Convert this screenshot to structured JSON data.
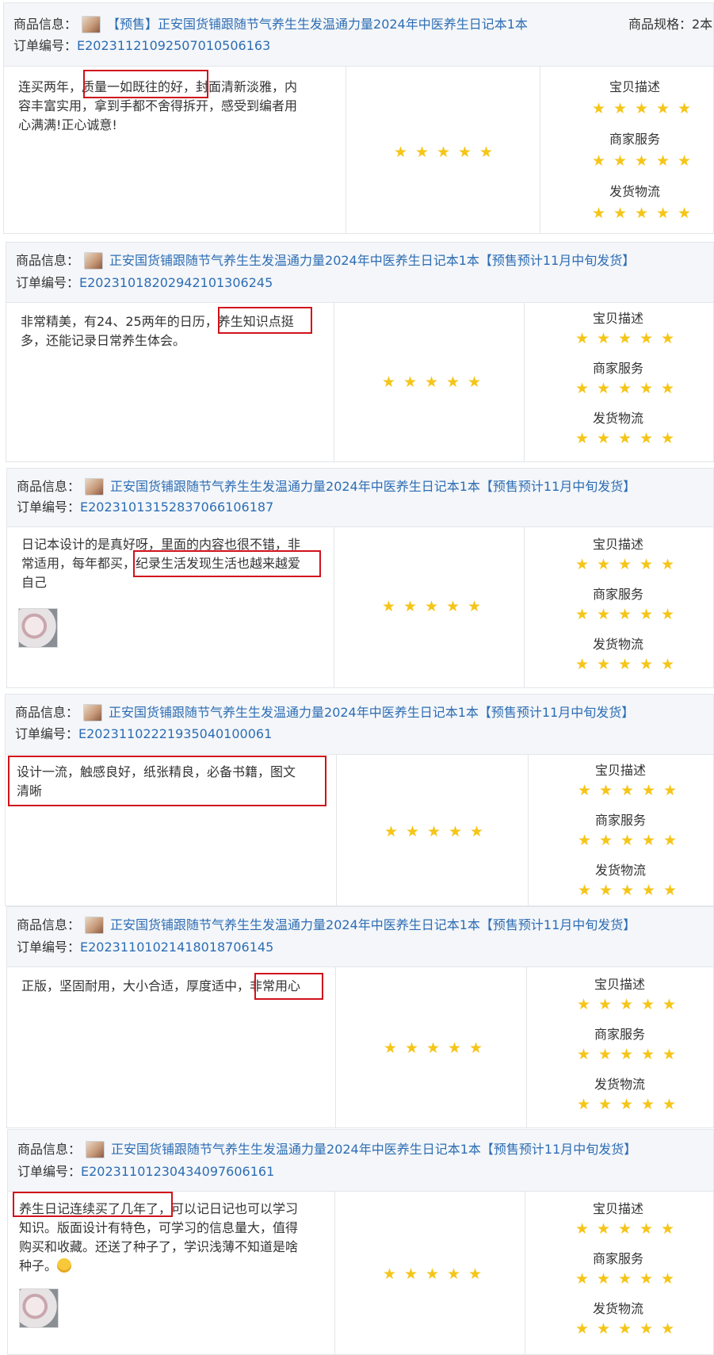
{
  "labels": {
    "product": "商品信息：",
    "order": "订单编号：",
    "spec": "商品规格：2本",
    "desc": "宝贝描述",
    "service": "商家服务",
    "logistics": "发货物流"
  },
  "star_glyph": "★",
  "star_color": "#f5c518",
  "highlight_color": "#d0121b",
  "link_color": "#2d6db4",
  "reviews": [
    {
      "product_title": "【预售】正安国货铺跟随节气养生生发温通力量2024年中医养生日记本1本",
      "order_no": "E20231121092507010506163",
      "text_lines": [
        "连买两年，质量一如既往的好，封面清新淡雅，内",
        "容丰富实用，拿到手都不舍得拆开，感受到编者用",
        "心满满!正心诚意!"
      ],
      "overall_rating": 5,
      "desc_rating": 5,
      "service_rating": 5,
      "logistics_rating": 5
    },
    {
      "product_title": "正安国货铺跟随节气养生生发温通力量2024年中医养生日记本1本【预售预计11月中旬发货】",
      "order_no": "E20231018202942101306245",
      "text_lines": [
        "非常精美，有24、25两年的日历，养生知识点挺",
        "多，还能记录日常养生体会。"
      ],
      "overall_rating": 5,
      "desc_rating": 5,
      "service_rating": 5,
      "logistics_rating": 5
    },
    {
      "product_title": "正安国货铺跟随节气养生生发温通力量2024年中医养生日记本1本【预售预计11月中旬发货】",
      "order_no": "E20231013152837066106187",
      "text_lines": [
        "日记本设计的是真好呀，里面的内容也很不错，非",
        "常适用，每年都买，纪录生活发现生活也越来越爱",
        "自己"
      ],
      "overall_rating": 5,
      "desc_rating": 5,
      "service_rating": 5,
      "logistics_rating": 5
    },
    {
      "product_title": "正安国货铺跟随节气养生生发温通力量2024年中医养生日记本1本【预售预计11月中旬发货】",
      "order_no": "E20231102221935040100061",
      "text_lines": [
        "设计一流，触感良好，纸张精良，必备书籍，图文",
        "清晰"
      ],
      "overall_rating": 5,
      "desc_rating": 5,
      "service_rating": 5,
      "logistics_rating": 5
    },
    {
      "product_title": "正安国货铺跟随节气养生生发温通力量2024年中医养生日记本1本【预售预计11月中旬发货】",
      "order_no": "E20231101021418018706145",
      "text_lines": [
        "正版，坚固耐用，大小合适，厚度适中，非常用心"
      ],
      "overall_rating": 5,
      "desc_rating": 5,
      "service_rating": 5,
      "logistics_rating": 5
    },
    {
      "product_title": "正安国货铺跟随节气养生生发温通力量2024年中医养生日记本1本【预售预计11月中旬发货】",
      "order_no": "E20231101230434097606161",
      "text_lines": [
        "养生日记连续买了几年了，可以记日记也可以学习",
        "知识。版面设计有特色，可学习的信息量大，值得",
        "购买和收藏。还送了种子了，学识浅薄不知道是啥",
        "种子。"
      ],
      "overall_rating": 5,
      "desc_rating": 5,
      "service_rating": 5,
      "logistics_rating": 5
    }
  ]
}
